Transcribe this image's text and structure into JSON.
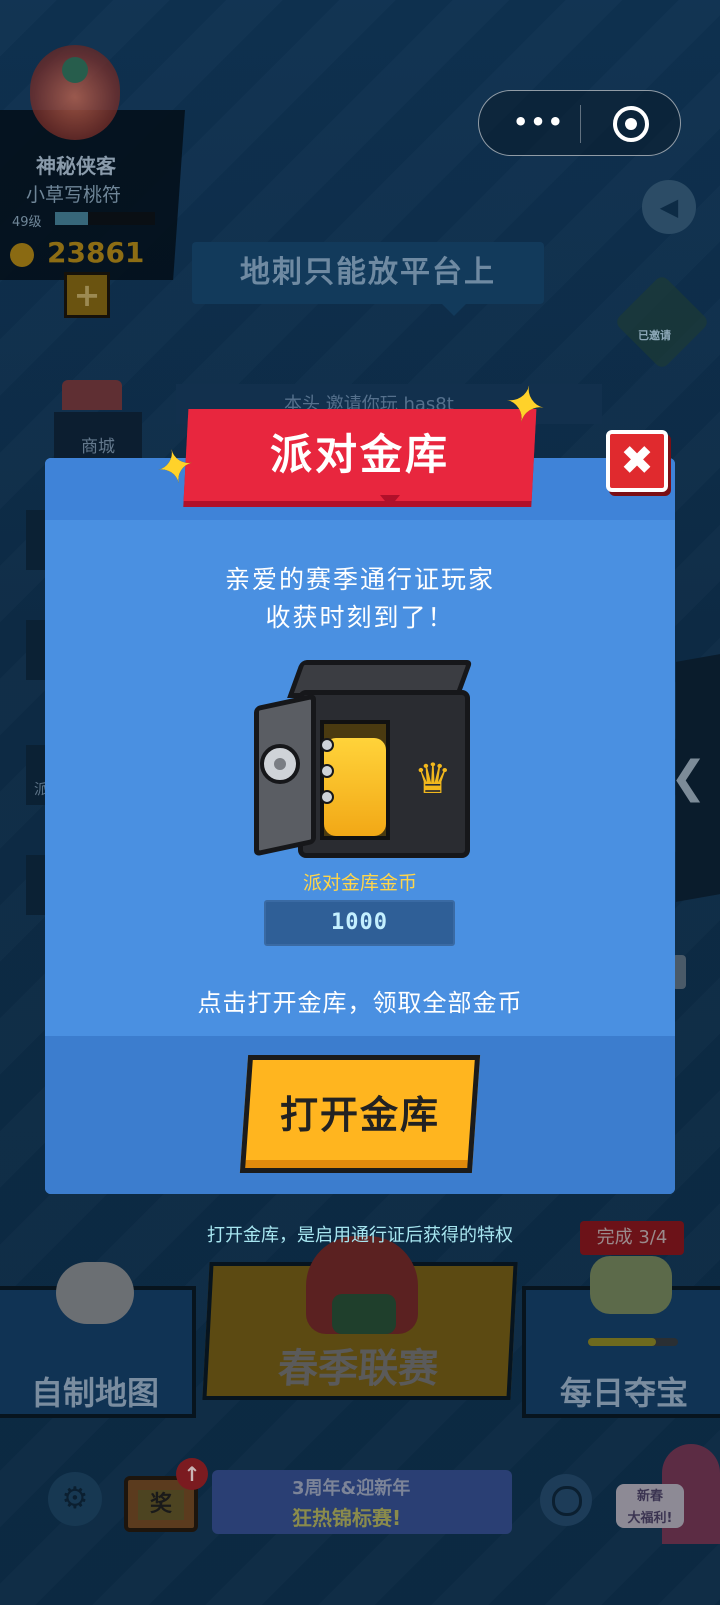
{
  "capsule": {
    "menu_glyph": "•••",
    "icon_menu": "more-dots-icon",
    "icon_close": "target-icon"
  },
  "profile": {
    "name": "神秘侠客",
    "title": "小草写桃符",
    "level": "49级",
    "level_progress": 0.33,
    "coins": "23861",
    "add_glyph": "+"
  },
  "tip": {
    "text": "地刺只能放平台上"
  },
  "badge": {
    "text": "已邀请"
  },
  "marquee": {
    "text": "本头 邀请你玩 has8t"
  },
  "shop": {
    "label": "商城"
  },
  "side": {
    "partial_label": "派"
  },
  "modal": {
    "title": "派对金库",
    "close_glyph": "✖",
    "greeting_line1": "亲爱的赛季通行证玩家",
    "greeting_line2": "收获时刻到了！",
    "vault_coins_label": "派对金库金币",
    "vault_coins_value": "1000",
    "hint": "点击打开金库，领取全部金币",
    "open_button": "打开金库",
    "crown_glyph": "♛"
  },
  "privilege_note": "打开金库，是启用通行证后获得的特权",
  "cards": {
    "left": "自制地图",
    "center": "春季联赛",
    "right": "每日夺宝",
    "right_status": "完成 3/4",
    "right_progress": 0.75
  },
  "bottom": {
    "tv_label": "奖",
    "tv_up_glyph": "↑",
    "banner_line1": "3周年&迎新年",
    "banner_line2": "狂热锦标赛!",
    "newyear_line1": "新春",
    "newyear_line2": "大福利!"
  },
  "colors": {
    "modal_bg": "#4a90e1",
    "ribbon": "#e8263e",
    "button": "#ffb51f",
    "vault_label": "#ffd54a"
  }
}
